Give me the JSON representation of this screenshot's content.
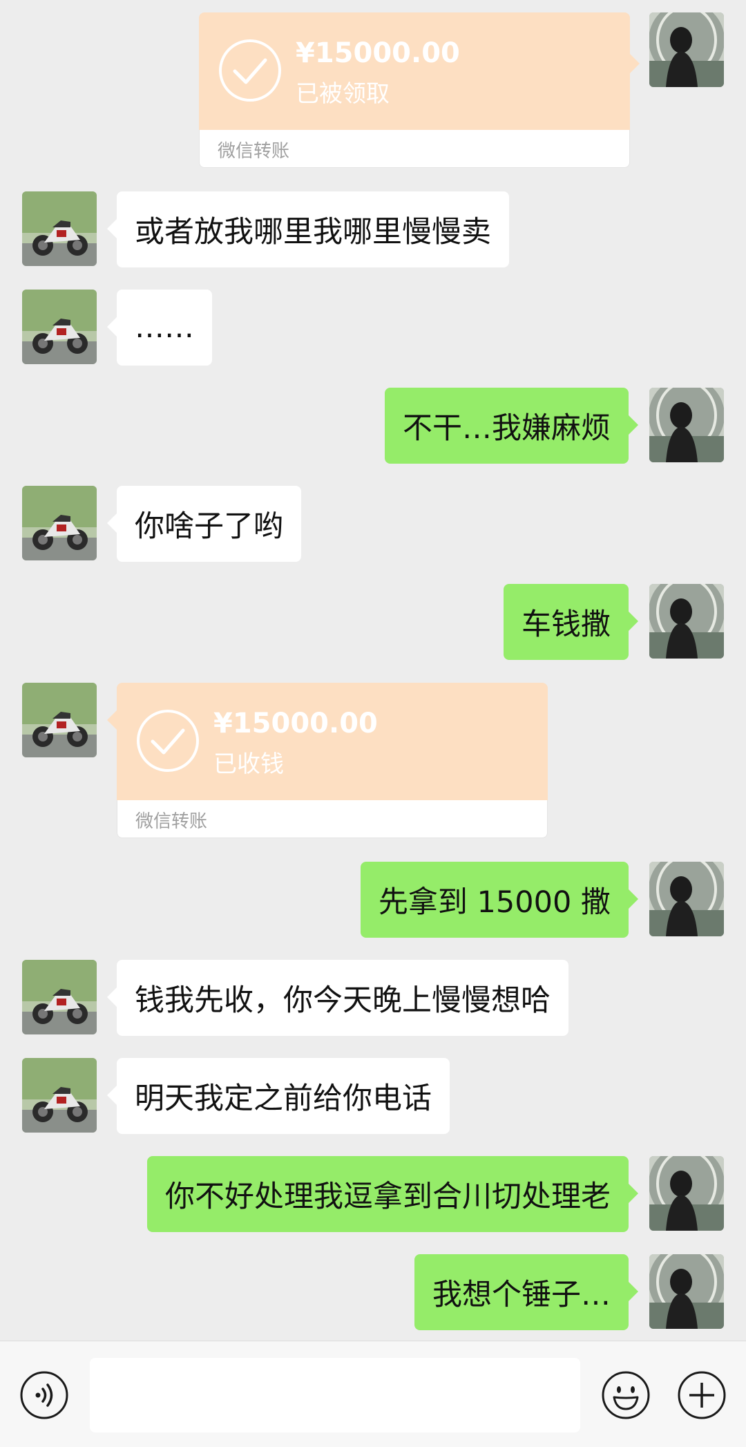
{
  "messages": [
    {
      "type": "transfer",
      "side": "out",
      "amount": "¥15000.00",
      "status": "已被领取",
      "label": "微信转账"
    },
    {
      "type": "text",
      "side": "in",
      "text": "或者放我哪里我哪里慢慢卖"
    },
    {
      "type": "text",
      "side": "in",
      "text": "……"
    },
    {
      "type": "text",
      "side": "out",
      "text": "不干…我嫌麻烦"
    },
    {
      "type": "text",
      "side": "in",
      "text": "你啥子了哟"
    },
    {
      "type": "text",
      "side": "out",
      "text": "车钱撒"
    },
    {
      "type": "transfer",
      "side": "in",
      "amount": "¥15000.00",
      "status": "已收钱",
      "label": "微信转账"
    },
    {
      "type": "text",
      "side": "out",
      "text": "先拿到 15000 撒"
    },
    {
      "type": "text",
      "side": "in",
      "text": "钱我先收，你今天晚上慢慢想哈"
    },
    {
      "type": "text",
      "side": "in",
      "text": "明天我定之前给你电话"
    },
    {
      "type": "text",
      "side": "out",
      "text": "你不好处理我逗拿到合川切处理老"
    },
    {
      "type": "text",
      "side": "out",
      "text": "我想个锤子…"
    }
  ],
  "input_bar": {
    "voice_icon": "voice-icon",
    "emoji_icon": "emoji-icon",
    "plus_icon": "plus-icon",
    "placeholder": ""
  },
  "colors": {
    "background": "#ededed",
    "outgoing_bubble": "#95ec69",
    "incoming_bubble": "#ffffff",
    "transfer_card": "#fddfc2"
  }
}
